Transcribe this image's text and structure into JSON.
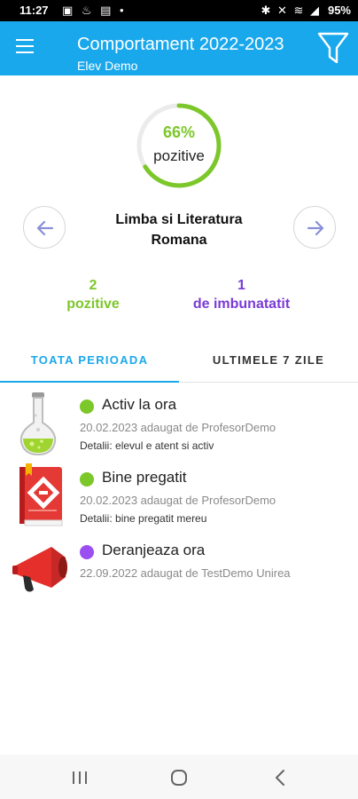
{
  "status_bar": {
    "time": "11:27",
    "left_icons": "▣ ♨ ▤ •",
    "right_icons": "✱ ✕ ≋ ◢",
    "battery": "95%"
  },
  "header": {
    "title": "Comportament 2022-2023",
    "subtitle": "Elev Demo",
    "background": "#1aa8ec"
  },
  "summary": {
    "percent_label": "66%",
    "percent_value": 66,
    "caption": "pozitive",
    "ring_color": "#7cc72a"
  },
  "subject": {
    "line1": "Limba si Literatura",
    "line2": "Romana"
  },
  "counts": {
    "positive_count": "2",
    "positive_label": "pozitive",
    "improve_count": "1",
    "improve_label": "de imbunatatit",
    "positive_color": "#7cc72a",
    "improve_color": "#7a3bd6"
  },
  "tabs": [
    {
      "label": "TOATA PERIOADA",
      "active": true
    },
    {
      "label": "ULTIMELE 7 ZILE",
      "active": false
    }
  ],
  "entries": [
    {
      "title": "Activ la ora",
      "meta": "20.02.2023 adaugat de ProfesorDemo",
      "details": "Detalii: elevul e atent si activ",
      "dot_color": "#7cc72a",
      "icon": "flask-icon"
    },
    {
      "title": "Bine pregatit",
      "meta": "20.02.2023 adaugat de ProfesorDemo",
      "details": "Detalii: bine pregatit mereu",
      "dot_color": "#7cc72a",
      "icon": "book-icon"
    },
    {
      "title": "Deranjeaza ora",
      "meta": "22.09.2022 adaugat de TestDemo Unirea",
      "details": "",
      "dot_color": "#9b4ff0",
      "icon": "megaphone-icon"
    }
  ],
  "system_nav": {
    "recents": "recents-icon",
    "home": "home-icon",
    "back": "back-icon"
  }
}
